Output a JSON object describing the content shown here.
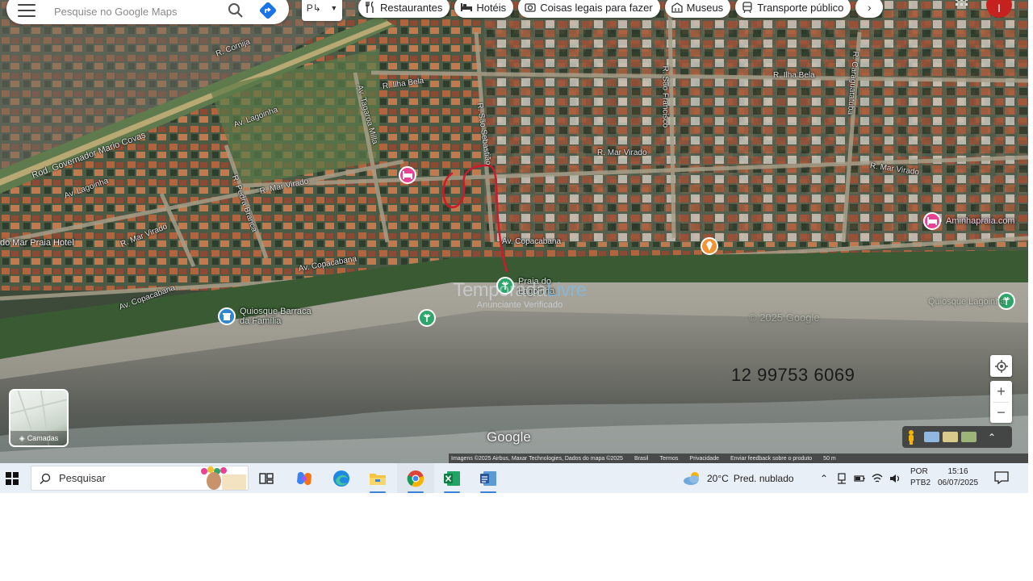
{
  "search": {
    "placeholder": "Pesquise no Google Maps"
  },
  "chips": [
    {
      "label": "Restaurantes",
      "icon": "fork-knife-icon"
    },
    {
      "label": "Hotéis",
      "icon": "bed-icon"
    },
    {
      "label": "Coisas legais para fazer",
      "icon": "camera-icon"
    },
    {
      "label": "Museus",
      "icon": "museum-icon"
    },
    {
      "label": "Transporte público",
      "icon": "transit-icon"
    }
  ],
  "account": {
    "initial": "I"
  },
  "streets": {
    "r_cornija": "R. Cornija",
    "rod_governador": "Rod. Governador Mario Covas",
    "av_lagoinha_1": "Av. Lagoinha",
    "av_lagoinha_2": "Av. Lagoinha",
    "av_tagaroa": "Av. Tagaroa Milla",
    "r_ilha_bela_1": "R. Ilha Bela",
    "r_ilha_bela_2": "R. Ilha Bela",
    "r_sao_sebastiao": "R. São Sebastião",
    "r_sao_francisco": "R. São Francisco",
    "r_caraguatatuba": "R. Caraguatatuba",
    "r_mar_virado_1": "R. Mar Virado",
    "r_mar_virado_2": "R. Mar Virado",
    "r_mar_virado_3": "R. Mar Virado",
    "r_mar_virado_4": "R. Mar Virado",
    "r_pedra_branca": "R. Pedra Branca",
    "av_copacabana_1": "Av. Copacabana",
    "av_copacabana_2": "Av. Copacabana",
    "av_copacabana_3": "Av. Copacabana"
  },
  "pois": {
    "hotel_left": "do Mar Praia Hotel",
    "quiosque": "Quiosque Barraca\nda Família",
    "praia": "Praia do\nLagoinha",
    "aminha": "Aminhapraia.com",
    "quiosque_right": "Quiosque Lagoinha",
    "watermark_top": "© 2025 Google"
  },
  "watermark": {
    "main_a": "Temporada",
    "main_b": "Livre",
    "sub": "Anunciante Verificado"
  },
  "phone": "12 99753 6069",
  "google_logo": "Google",
  "layers": {
    "label": "Camadas"
  },
  "attribution": [
    "Imagens ©2025 Airbus, Maxar Technologies, Dados do mapa ©2025",
    "Brasil",
    "Termos",
    "Privacidade",
    "Enviar feedback sobre o produto",
    "50 m"
  ],
  "taskbar": {
    "search_label": "Pesquisar",
    "temperature": "20°C",
    "weather_text": "Pred. nublado",
    "lang_1": "POR",
    "lang_2": "PTB2",
    "time": "15:16",
    "date": "06/07/2025"
  },
  "colors": {
    "route": "#d0192a",
    "hotel_pin": "#e84393",
    "attraction_pin": "#f29334",
    "park_pin": "#2ea56a",
    "museum_pin": "#2f86d1"
  }
}
